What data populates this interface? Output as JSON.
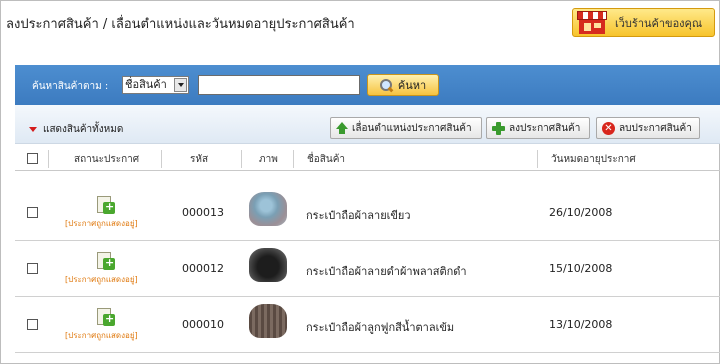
{
  "header": {
    "title": "ลงประกาศสินค้า / เลื่อนตำแหน่งและวันหมดอายุประกาศสินค้า",
    "store_button": "เว็บร้านค้าของคุณ"
  },
  "search": {
    "label": "ค้นหาสินค้าตาม :",
    "field_option": "ชื่อสินค้า",
    "value": "",
    "button": "ค้นหา"
  },
  "toolbar": {
    "show_all": "แสดงสินค้าทั้งหมด",
    "move_button": "เลื่อนตำแหน่งประกาศสินค้า",
    "add_button": "ลงประกาศสินค้า",
    "delete_button": "ลบประกาศสินค้า"
  },
  "table": {
    "headers": {
      "status": "สถานะประกาศ",
      "code": "รหัส",
      "image": "ภาพ",
      "name": "ชื่อสินค้า",
      "expiry": "วันหมดอายุประกาศ"
    },
    "rows": [
      {
        "status": "[ประกาศถูกแสดงอยู่]",
        "code": "000013",
        "name": "กระเป๋าถือผ้าลายเขียว",
        "expiry": "26/10/2008"
      },
      {
        "status": "[ประกาศถูกแสดงอยู่]",
        "code": "000012",
        "name": "กระเป๋าถือผ้าลายดำผ้าพลาสติกดำ",
        "expiry": "15/10/2008"
      },
      {
        "status": "[ประกาศถูกแสดงอยู่]",
        "code": "000010",
        "name": "กระเป๋าถือผ้าลูกฟูกสีน้ำตาลเข้ม",
        "expiry": "13/10/2008"
      }
    ]
  },
  "colors": {
    "search_bar": "#4688cc",
    "accent_button": "#f6c340",
    "status_text": "#e07a10"
  }
}
